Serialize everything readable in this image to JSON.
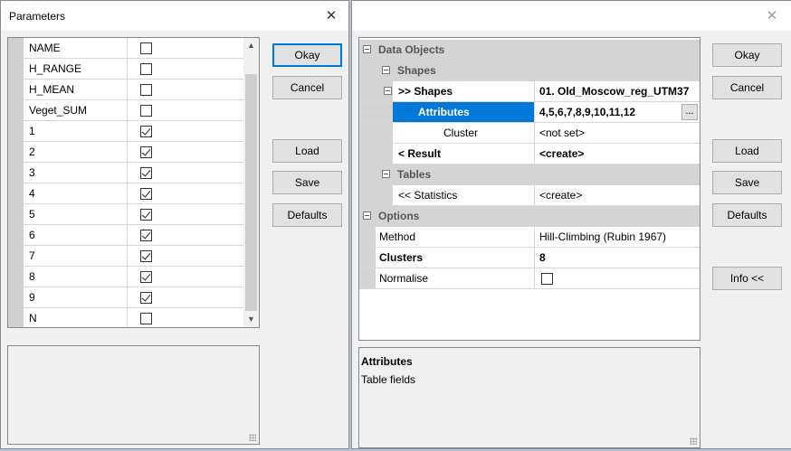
{
  "left_dialog": {
    "title": "Parameters",
    "close_glyph": "✕",
    "fields": [
      {
        "name": "NAME",
        "checked": false
      },
      {
        "name": "H_RANGE",
        "checked": false
      },
      {
        "name": "H_MEAN",
        "checked": false
      },
      {
        "name": "Veget_SUM",
        "checked": false
      },
      {
        "name": "1",
        "checked": true
      },
      {
        "name": "2",
        "checked": true
      },
      {
        "name": "3",
        "checked": true
      },
      {
        "name": "4",
        "checked": true
      },
      {
        "name": "5",
        "checked": true
      },
      {
        "name": "6",
        "checked": true
      },
      {
        "name": "7",
        "checked": true
      },
      {
        "name": "8",
        "checked": true
      },
      {
        "name": "9",
        "checked": true
      },
      {
        "name": "N",
        "checked": false
      }
    ],
    "buttons": {
      "okay": "Okay",
      "cancel": "Cancel",
      "load": "Load",
      "save": "Save",
      "defaults": "Defaults"
    }
  },
  "right_dialog": {
    "close_glyph": "✕",
    "grid": {
      "data_objects": "Data Objects",
      "shapes_group": "Shapes",
      "shapes_label": ">> Shapes",
      "shapes_value": "01. Old_Moscow_reg_UTM37",
      "attributes_label": "Attributes",
      "attributes_value": "4,5,6,7,8,9,10,11,12",
      "ellipsis": "...",
      "cluster_label": "Cluster",
      "cluster_value": "<not set>",
      "result_label": "< Result",
      "result_value": "<create>",
      "tables_group": "Tables",
      "statistics_label": "<< Statistics",
      "statistics_value": "<create>",
      "options": "Options",
      "method_label": "Method",
      "method_value": "Hill-Climbing (Rubin 1967)",
      "clusters_label": "Clusters",
      "clusters_value": "8",
      "normalise_label": "Normalise",
      "normalise_checked": false
    },
    "description": {
      "title": "Attributes",
      "text": "Table fields"
    },
    "buttons": {
      "okay": "Okay",
      "cancel": "Cancel",
      "load": "Load",
      "save": "Save",
      "defaults": "Defaults",
      "info": "Info <<"
    }
  }
}
